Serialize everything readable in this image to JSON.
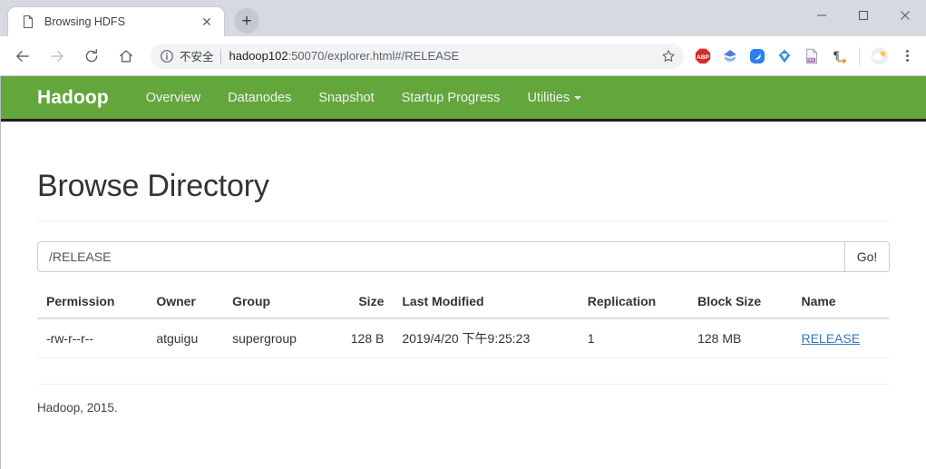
{
  "window": {
    "minimize_label": "—",
    "maximize_label": "□",
    "close_label": "×"
  },
  "browser": {
    "tab": {
      "title": "Browsing HDFS",
      "favicon": "page-icon",
      "close_label": "✕"
    },
    "newtab_label": "+",
    "nav": {
      "back_label": "←",
      "forward_label": "→",
      "reload_label": "⟳",
      "home_label": "⌂"
    },
    "omnibox": {
      "security_label": "不安全",
      "url_host": "hadoop102",
      "url_rest": ":50070/explorer.html#/RELEASE",
      "star_label": "☆"
    },
    "extensions": [
      {
        "name": "adblock-plus-icon",
        "label": "ABP"
      },
      {
        "name": "gem-icon",
        "label": ""
      },
      {
        "name": "blue-circle-icon",
        "label": ""
      },
      {
        "name": "v-diamond-icon",
        "label": ""
      },
      {
        "name": "pdf-icon",
        "label": "PDF"
      },
      {
        "name": "pilcrow-icon",
        "label": "¶"
      },
      {
        "name": "weather-icon",
        "label": ""
      }
    ]
  },
  "site": {
    "navbar": {
      "brand": "Hadoop",
      "brand_color": "#ffffff",
      "background_color": "#63a63c",
      "items": [
        {
          "label": "Overview",
          "has_caret": false
        },
        {
          "label": "Datanodes",
          "has_caret": false
        },
        {
          "label": "Snapshot",
          "has_caret": false
        },
        {
          "label": "Startup Progress",
          "has_caret": false
        },
        {
          "label": "Utilities",
          "has_caret": true
        }
      ]
    },
    "page_title": "Browse Directory",
    "path_form": {
      "value": "/RELEASE",
      "placeholder": "",
      "go_label": "Go!"
    },
    "table": {
      "headers": [
        "Permission",
        "Owner",
        "Group",
        "Size",
        "Last Modified",
        "Replication",
        "Block Size",
        "Name"
      ],
      "rows": [
        {
          "permission": "-rw-r--r--",
          "owner": "atguigu",
          "group": "supergroup",
          "size": "128 B",
          "last_modified": "2019/4/20 下午9:25:23",
          "replication": "1",
          "block_size": "128 MB",
          "name": "RELEASE",
          "name_color": "#337ab7"
        }
      ]
    },
    "footer": "Hadoop, 2015."
  }
}
